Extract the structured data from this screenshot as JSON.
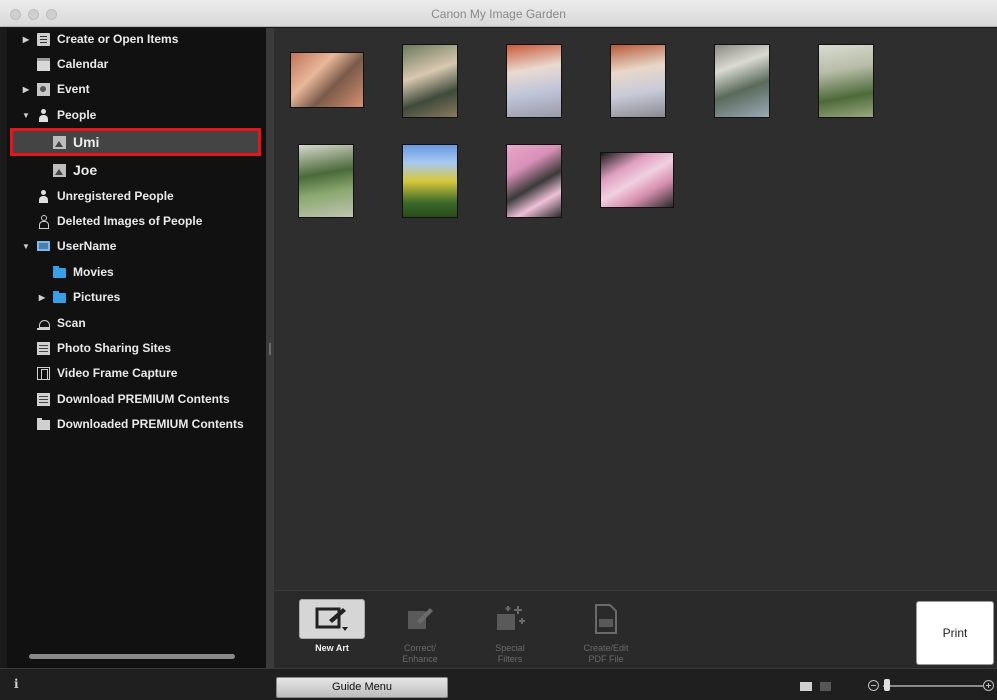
{
  "window": {
    "title": "Canon My Image Garden"
  },
  "sidebar": {
    "items": [
      {
        "label": "Create or Open Items",
        "icon": "create-items-icon",
        "expander": "collapsed"
      },
      {
        "label": "Calendar",
        "icon": "calendar-icon",
        "expander": "none"
      },
      {
        "label": "Event",
        "icon": "event-icon",
        "expander": "collapsed"
      },
      {
        "label": "People",
        "icon": "people-icon",
        "expander": "expanded"
      },
      {
        "label": "Umi",
        "icon": "person-photo-icon",
        "expander": "none",
        "selected": true
      },
      {
        "label": "Joe",
        "icon": "person-photo-icon",
        "expander": "none"
      },
      {
        "label": "Unregistered People",
        "icon": "unregistered-people-icon",
        "expander": "none"
      },
      {
        "label": "Deleted Images of People",
        "icon": "deleted-people-icon",
        "expander": "none"
      },
      {
        "label": "UserName",
        "icon": "computer-icon",
        "expander": "expanded"
      },
      {
        "label": "Movies",
        "icon": "folder-icon",
        "expander": "none"
      },
      {
        "label": "Pictures",
        "icon": "folder-icon",
        "expander": "collapsed"
      },
      {
        "label": "Scan",
        "icon": "scan-icon",
        "expander": "none"
      },
      {
        "label": "Photo Sharing Sites",
        "icon": "photo-sharing-icon",
        "expander": "none"
      },
      {
        "label": "Video Frame Capture",
        "icon": "video-capture-icon",
        "expander": "none"
      },
      {
        "label": "Download PREMIUM Contents",
        "icon": "download-icon",
        "expander": "none"
      },
      {
        "label": "Downloaded PREMIUM Contents",
        "icon": "downloaded-folder-icon",
        "expander": "none"
      }
    ]
  },
  "toolbar": {
    "new_art": "New Art",
    "correct_enhance": "Correct/\nEnhance",
    "special_filters": "Special\nFilters",
    "create_edit_pdf": "Create/Edit\nPDF File",
    "print": "Print"
  },
  "statusbar": {
    "info_icon": "i",
    "guide_menu": "Guide Menu"
  },
  "colors": {
    "selection_outline": "#e8141c",
    "sidebar_bg": "#111111",
    "content_bg": "#2e2e2e"
  }
}
